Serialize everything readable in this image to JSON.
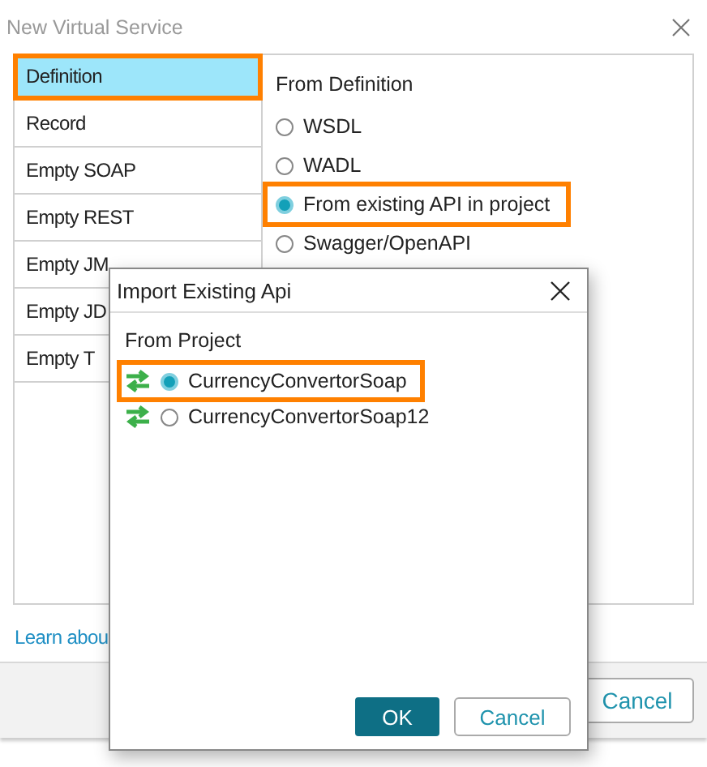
{
  "window": {
    "title": "New Virtual Service"
  },
  "sidebar": {
    "items": [
      {
        "label": "Definition",
        "selected": true,
        "highlighted": true
      },
      {
        "label": "Record",
        "selected": false,
        "highlighted": false
      },
      {
        "label": "Empty SOAP",
        "selected": false,
        "highlighted": false
      },
      {
        "label": "Empty REST",
        "selected": false,
        "highlighted": false
      },
      {
        "label": "Empty JM",
        "selected": false,
        "highlighted": false
      },
      {
        "label": "Empty JD",
        "selected": false,
        "highlighted": false
      },
      {
        "label": "Empty T",
        "selected": false,
        "highlighted": false
      }
    ]
  },
  "content": {
    "heading": "From Definition",
    "options": [
      {
        "label": "WSDL",
        "selected": false,
        "highlighted": false
      },
      {
        "label": "WADL",
        "selected": false,
        "highlighted": false
      },
      {
        "label": "From existing API in project",
        "selected": true,
        "highlighted": true
      },
      {
        "label": "Swagger/OpenAPI",
        "selected": false,
        "highlighted": false
      }
    ]
  },
  "link": "Learn abou",
  "footer": {
    "buttons": [
      "Cancel"
    ]
  },
  "modal": {
    "title": "Import Existing Api",
    "section": "From Project",
    "options": [
      {
        "label": "CurrencyConvertorSoap",
        "selected": true,
        "highlighted": true
      },
      {
        "label": "CurrencyConvertorSoap12",
        "selected": false,
        "highlighted": false
      }
    ],
    "buttons": [
      {
        "label": "OK",
        "kind": "primary"
      },
      {
        "label": "Cancel",
        "kind": "secondary"
      }
    ]
  }
}
